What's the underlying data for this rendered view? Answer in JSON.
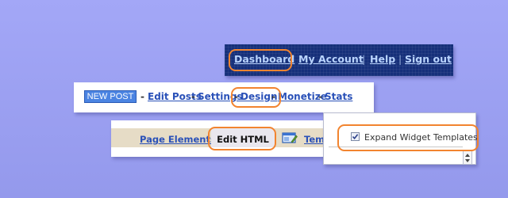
{
  "top_nav": {
    "dashboard": "Dashboard",
    "my_account": "My Account",
    "help": "Help",
    "sign_out": "Sign out",
    "separator": "|"
  },
  "post_nav": {
    "new_post": "NEW POST",
    "edit_posts": "Edit Posts",
    "settings": "Settings",
    "design": "Design",
    "monetize": "Monetize",
    "stats": "Stats",
    "separator": "-"
  },
  "design_tabs": {
    "page_elements": "Page Elements",
    "edit_html": "Edit HTML",
    "template_truncated": "Tem"
  },
  "widget_panel": {
    "expand_label": "Expand Widget Templates",
    "checked": true
  },
  "colors": {
    "background": "#a3a7f7",
    "topbar": "#16307a",
    "highlight": "#f2842f",
    "link": "#2a51b8",
    "new_post_button": "#4b84e2",
    "tabstrip": "#e6dcc6"
  },
  "icons": [
    "template-designer-icon",
    "checkbox-checked-icon",
    "scroll-up-icon",
    "scroll-down-icon"
  ]
}
